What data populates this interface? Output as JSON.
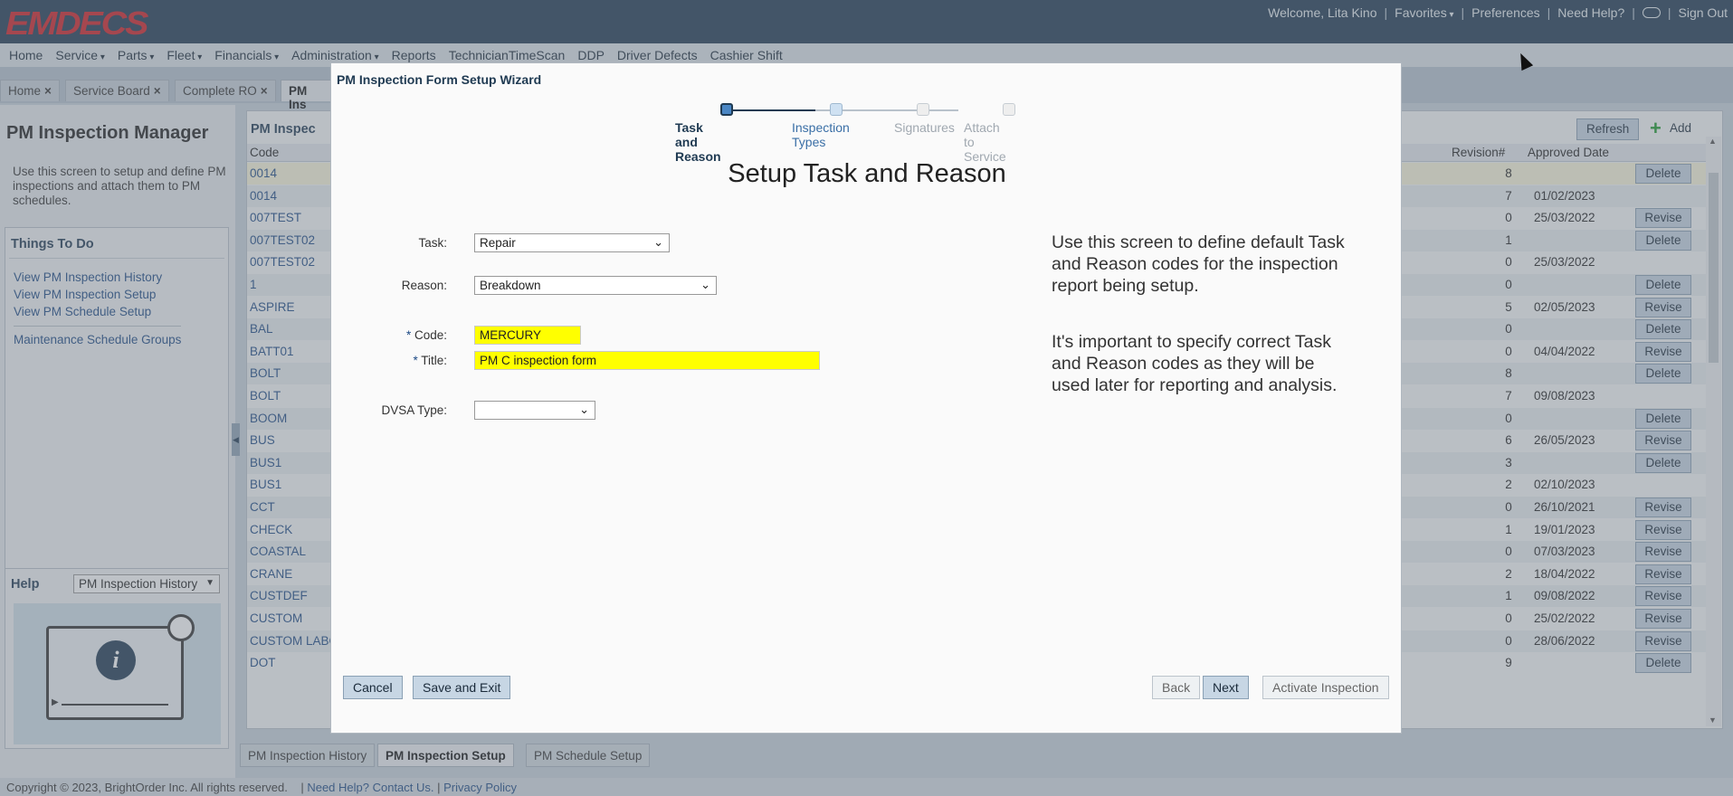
{
  "header": {
    "logo": "EMDECS",
    "welcome": "Welcome, Lita Kino",
    "favorites": "Favorites",
    "preferences": "Preferences",
    "need_help": "Need Help?",
    "sign_out": "Sign Out"
  },
  "nav": {
    "items": [
      "Home",
      "Service",
      "Parts",
      "Fleet",
      "Financials",
      "Administration",
      "Reports",
      "TechnicianTimeScan",
      "DDP",
      "Driver Defects",
      "Cashier Shift"
    ]
  },
  "page_tabs": [
    "Home",
    "Service Board",
    "Complete RO",
    "PM Ins"
  ],
  "left": {
    "title": "PM Inspection Manager",
    "description": "Use this screen to setup and define PM inspections and attach them to PM schedules.",
    "todo_title": "Things To Do",
    "todo_links": [
      "View PM Inspection History",
      "View PM Inspection Setup",
      "View PM Schedule Setup",
      "Maintenance Schedule Groups"
    ],
    "help_title": "Help",
    "help_select": "PM Inspection History"
  },
  "grid": {
    "title": "PM Inspec",
    "refresh": "Refresh",
    "add": "Add",
    "columns": {
      "code": "Code",
      "revision": "Revision#",
      "approved": "Approved Date"
    },
    "rows": [
      {
        "code": "0014",
        "rev": "8",
        "date": "",
        "action": "Delete"
      },
      {
        "code": "0014",
        "rev": "7",
        "date": "01/02/2023",
        "action": ""
      },
      {
        "code": "007TEST",
        "rev": "0",
        "date": "25/03/2022",
        "action": "Revise"
      },
      {
        "code": "007TEST02",
        "rev": "1",
        "date": "",
        "action": "Delete"
      },
      {
        "code": "007TEST02",
        "rev": "0",
        "date": "25/03/2022",
        "action": ""
      },
      {
        "code": "1",
        "rev": "0",
        "date": "",
        "action": "Delete"
      },
      {
        "code": "ASPIRE",
        "rev": "5",
        "date": "02/05/2023",
        "action": "Revise"
      },
      {
        "code": "BAL",
        "rev": "0",
        "date": "",
        "action": "Delete"
      },
      {
        "code": "BATT01",
        "rev": "0",
        "date": "04/04/2022",
        "action": "Revise"
      },
      {
        "code": "BOLT",
        "rev": "8",
        "date": "",
        "action": "Delete"
      },
      {
        "code": "BOLT",
        "rev": "7",
        "date": "09/08/2023",
        "action": ""
      },
      {
        "code": "BOOM",
        "rev": "0",
        "date": "",
        "action": "Delete"
      },
      {
        "code": "BUS",
        "rev": "6",
        "date": "26/05/2023",
        "action": "Revise"
      },
      {
        "code": "BUS1",
        "rev": "3",
        "date": "",
        "action": "Delete"
      },
      {
        "code": "BUS1",
        "rev": "2",
        "date": "02/10/2023",
        "action": ""
      },
      {
        "code": "CCT",
        "rev": "0",
        "date": "26/10/2021",
        "action": "Revise"
      },
      {
        "code": "CHECK",
        "rev": "1",
        "date": "19/01/2023",
        "action": "Revise"
      },
      {
        "code": "COASTAL",
        "rev": "0",
        "date": "07/03/2023",
        "action": "Revise"
      },
      {
        "code": "CRANE",
        "rev": "2",
        "date": "18/04/2022",
        "action": "Revise"
      },
      {
        "code": "CUSTDEF",
        "rev": "1",
        "date": "09/08/2022",
        "action": "Revise"
      },
      {
        "code": "CUSTOM",
        "rev": "0",
        "date": "25/02/2022",
        "action": "Revise"
      },
      {
        "code": "CUSTOM LABO",
        "rev": "0",
        "date": "28/06/2022",
        "action": "Revise"
      },
      {
        "code": "DOT",
        "rev": "9",
        "date": "",
        "action": "Delete"
      }
    ]
  },
  "sub_tabs": [
    "PM Inspection History",
    "PM Inspection Setup",
    "PM Schedule Setup"
  ],
  "footer": {
    "copyright": "Copyright © 2023, BrightOrder Inc. All rights reserved.",
    "help": "Need Help? Contact Us.",
    "privacy": "Privacy Policy"
  },
  "modal": {
    "title": "PM Inspection Form Setup Wizard",
    "steps": [
      "Task and Reason",
      "Inspection Types",
      "Signatures",
      "Attach to Service"
    ],
    "heading": "Setup Task and Reason",
    "task_label": "Task:",
    "task_value": "Repair",
    "reason_label": "Reason:",
    "reason_value": "Breakdown",
    "code_label": "Code:",
    "code_value": "MERCURY",
    "title_label": "Title:",
    "title_value": "PM C inspection form",
    "dvsa_label": "DVSA Type:",
    "dvsa_value": "",
    "help1": "Use this screen to define default Task and Reason codes for the inspection report being setup.",
    "help2": "It's important to specify correct Task and Reason codes as they will be used later for reporting and analysis.",
    "buttons": {
      "cancel": "Cancel",
      "save_exit": "Save and Exit",
      "back": "Back",
      "next": "Next",
      "activate": "Activate Inspection"
    }
  }
}
